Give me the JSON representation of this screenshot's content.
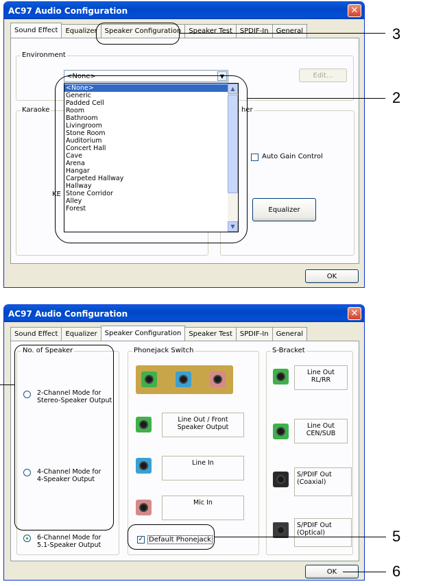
{
  "window1": {
    "title": "AC97 Audio Configuration",
    "tabs": [
      "Sound Effect",
      "Equalizer",
      "Speaker Configuration",
      "Speaker Test",
      "SPDIF-In",
      "General"
    ],
    "active_tab": "Sound Effect",
    "environment": {
      "legend": "Environment",
      "selected": "<None>",
      "edit_label": "Edit...",
      "options": [
        "<None>",
        "Generic",
        "Padded Cell",
        "Room",
        "Bathroom",
        "Livingroom",
        "Stone Room",
        "Auditorium",
        "Concert Hall",
        "Cave",
        "Arena",
        "Hangar",
        "Carpeted Hallway",
        "Hallway",
        "Stone Corridor",
        "Alley",
        "Forest"
      ]
    },
    "karaoke": {
      "legend": "Karaoke",
      "partial_label": "KE"
    },
    "other": {
      "legend_partial": "her",
      "auto_gain_label": "Auto Gain Control",
      "equalizer_button": "Equalizer"
    },
    "ok_label": "OK"
  },
  "window2": {
    "title": "AC97 Audio Configuration",
    "tabs": [
      "Sound Effect",
      "Equalizer",
      "Speaker Configuration",
      "Speaker Test",
      "SPDIF-In",
      "General"
    ],
    "active_tab": "Speaker Configuration",
    "no_of_speaker": {
      "legend": "No. of Speaker",
      "options": [
        {
          "line1": "2-Channel Mode for",
          "line2": "Stereo-Speaker Output",
          "selected": false
        },
        {
          "line1": "4-Channel Mode for",
          "line2": "4-Speaker Output",
          "selected": false
        },
        {
          "line1": "6-Channel Mode for",
          "line2": "5.1-Speaker Output",
          "selected": true
        }
      ]
    },
    "phonejack": {
      "legend": "Phonejack Switch",
      "jacks": [
        {
          "line1": "Line Out / Front",
          "line2": "Speaker Output",
          "color": "#3fb04a"
        },
        {
          "line1": "Line In",
          "line2": "",
          "color": "#3aa0d0"
        },
        {
          "line1": "Mic In",
          "line2": "",
          "color": "#d58a8a"
        }
      ],
      "default_label": "Default Phonejack",
      "default_checked": true
    },
    "sbracket": {
      "legend": "S-Bracket",
      "items": [
        {
          "line1": "Line Out",
          "line2": "RL/RR"
        },
        {
          "line1": "Line Out",
          "line2": "CEN/SUB"
        },
        {
          "line1": "S/PDIF Out (Coaxial)",
          "line2": ""
        },
        {
          "line1": "S/PDIF Out (Optical)",
          "line2": ""
        }
      ]
    },
    "ok_label": "OK"
  },
  "callouts": [
    "3",
    "2",
    "5",
    "6"
  ],
  "colors": {
    "titlebar": "#0046c8",
    "selection": "#316ac5",
    "face": "#ece9d8"
  }
}
